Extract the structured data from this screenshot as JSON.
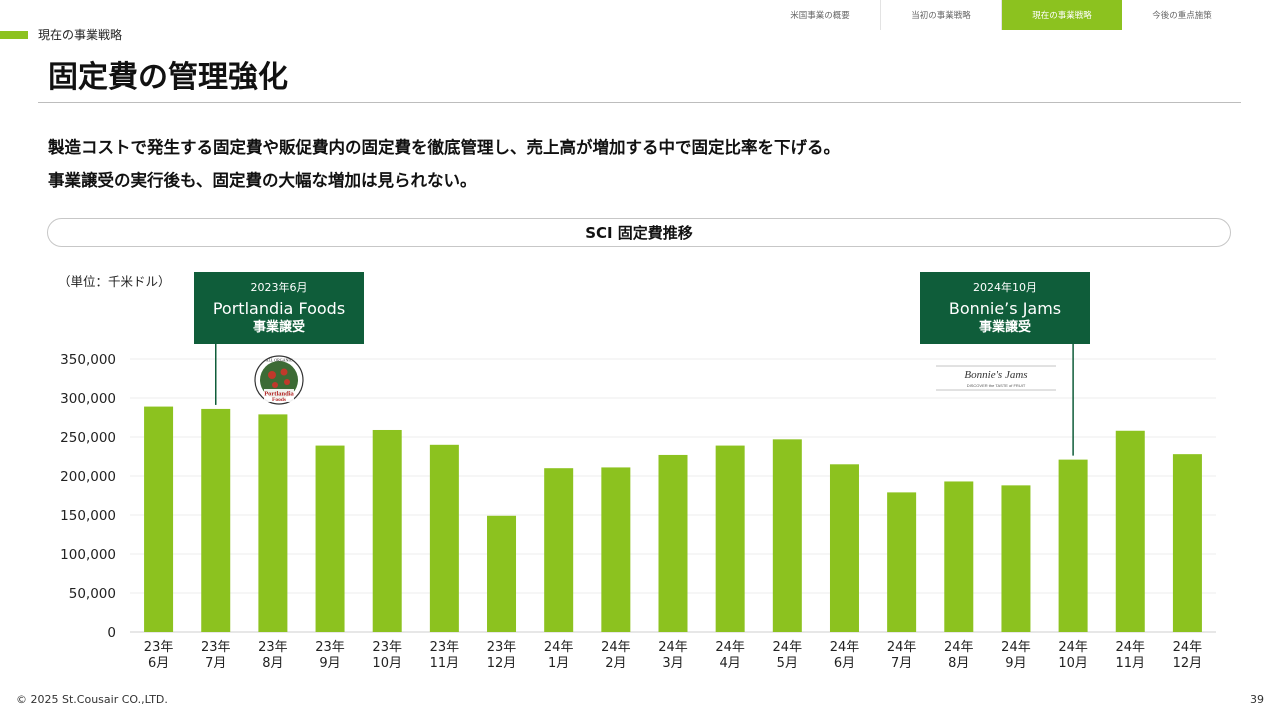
{
  "section": {
    "label": "現在の事業戦略"
  },
  "nav": {
    "items": [
      {
        "label": "米国事業の概要",
        "active": false
      },
      {
        "label": "当初の事業戦略",
        "active": false
      },
      {
        "label": "現在の事業戦略",
        "active": true
      },
      {
        "label": "今後の重点施策",
        "active": false
      }
    ]
  },
  "page": {
    "title": "固定費の管理強化",
    "lead_line1": "製造コストで発生する固定費や販促費内の固定費を徹底管理し、売上高が増加する中で固定比率を下げる。",
    "lead_line2": "事業譲受の実行後も、固定費の大幅な増加は見られない。"
  },
  "chart_data": {
    "type": "bar",
    "title": "SCI 固定費推移",
    "unit_label": "（単位：千米ドル）",
    "categories": [
      [
        "23年",
        "6月"
      ],
      [
        "23年",
        "7月"
      ],
      [
        "23年",
        "8月"
      ],
      [
        "23年",
        "9月"
      ],
      [
        "23年",
        "10月"
      ],
      [
        "23年",
        "11月"
      ],
      [
        "23年",
        "12月"
      ],
      [
        "24年",
        "1月"
      ],
      [
        "24年",
        "2月"
      ],
      [
        "24年",
        "3月"
      ],
      [
        "24年",
        "4月"
      ],
      [
        "24年",
        "5月"
      ],
      [
        "24年",
        "6月"
      ],
      [
        "24年",
        "7月"
      ],
      [
        "24年",
        "8月"
      ],
      [
        "24年",
        "9月"
      ],
      [
        "24年",
        "10月"
      ],
      [
        "24年",
        "11月"
      ],
      [
        "24年",
        "12月"
      ]
    ],
    "values": [
      289000,
      286000,
      279000,
      239000,
      259000,
      240000,
      149000,
      210000,
      211000,
      227000,
      239000,
      247000,
      215000,
      179000,
      193000,
      188000,
      221000,
      258000,
      228000
    ],
    "ylim": [
      0,
      350000
    ],
    "yticks": [
      0,
      50000,
      100000,
      150000,
      200000,
      250000,
      300000,
      350000
    ],
    "ytick_labels": [
      "0",
      "50,000",
      "100,000",
      "150,000",
      "200,000",
      "250,000",
      "300,000",
      "350,000"
    ],
    "grid": true,
    "bar_color": "#8cc21f",
    "annotations": [
      {
        "date": "2023年6月",
        "name": "Portlandia Foods",
        "note": "事業譲受",
        "category_index": 1
      },
      {
        "date": "2024年10月",
        "name": "Bonnie’s Jams",
        "note": "事業譲受",
        "category_index": 16
      }
    ]
  },
  "logos": {
    "portlandia": {
      "line1": "ALL ORGANIC",
      "line2": "Portlandia",
      "line3": "Foods"
    },
    "bonnies": {
      "name": "Bonnie's Jams",
      "tagline": "DISCOVER the TASTE of FRUIT"
    }
  },
  "colors": {
    "accent": "#8cc21f",
    "callout_bg": "#0f5d3a",
    "grid": "#eeeeee"
  },
  "footer": {
    "copyright": "© 2025 St.Cousair CO.,LTD.",
    "page_number": "39"
  }
}
